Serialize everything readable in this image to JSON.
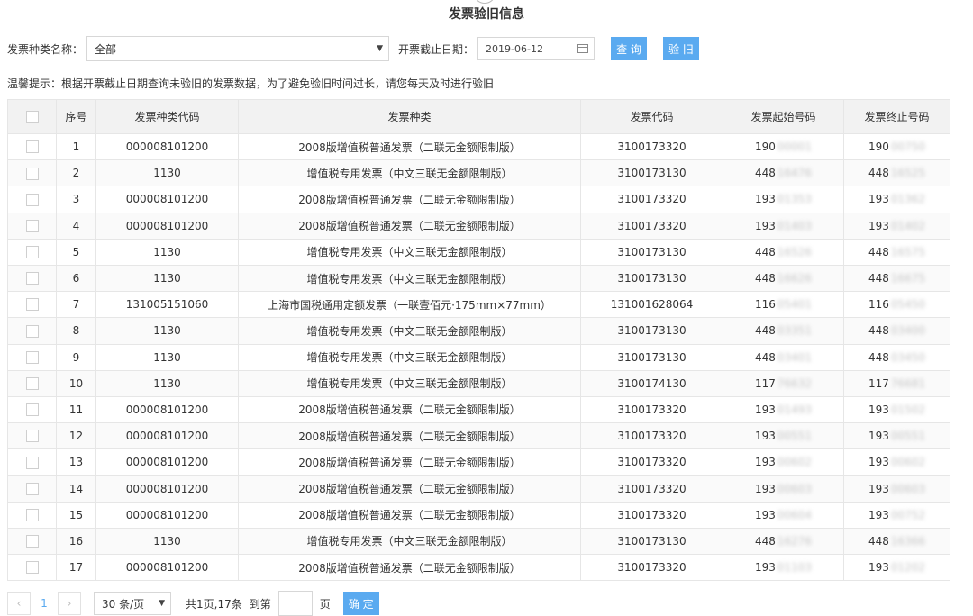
{
  "title": "发票验旧信息",
  "filters": {
    "type_label": "发票种类名称：",
    "type_value": "全部",
    "date_label": "开票截止日期：",
    "date_value": "2019-06-12",
    "query_label": "查 询",
    "check_label": "验 旧"
  },
  "tip": "温馨提示：根据开票截止日期查询未验旧的发票数据，为了避免验旧时间过长，请您每天及时进行验旧",
  "table": {
    "headers": {
      "seq": "序号",
      "type_code": "发票种类代码",
      "type_name": "发票种类",
      "invoice_code": "发票代码",
      "start_no": "发票起始号码",
      "end_no": "发票终止号码"
    },
    "rows": [
      {
        "seq": "1",
        "type_code": "000008101200",
        "type_name": "2008版增值税普通发票（二联无金额限制版）",
        "invoice_code": "3100173320",
        "start_no": "190",
        "start_no_hidden": "00001",
        "end_no": "190",
        "end_no_hidden": "00750"
      },
      {
        "seq": "2",
        "type_code": "1130",
        "type_name": "增值税专用发票（中文三联无金额限制版）",
        "invoice_code": "3100173130",
        "start_no": "448",
        "start_no_hidden": "16476",
        "end_no": "448",
        "end_no_hidden": "16525"
      },
      {
        "seq": "3",
        "type_code": "000008101200",
        "type_name": "2008版增值税普通发票（二联无金额限制版）",
        "invoice_code": "3100173320",
        "start_no": "193",
        "start_no_hidden": "01353",
        "end_no": "193",
        "end_no_hidden": "01362"
      },
      {
        "seq": "4",
        "type_code": "000008101200",
        "type_name": "2008版增值税普通发票（二联无金额限制版）",
        "invoice_code": "3100173320",
        "start_no": "193",
        "start_no_hidden": "01403",
        "end_no": "193",
        "end_no_hidden": "01402"
      },
      {
        "seq": "5",
        "type_code": "1130",
        "type_name": "增值税专用发票（中文三联无金额限制版）",
        "invoice_code": "3100173130",
        "start_no": "448",
        "start_no_hidden": "16526",
        "end_no": "448",
        "end_no_hidden": "16575"
      },
      {
        "seq": "6",
        "type_code": "1130",
        "type_name": "增值税专用发票（中文三联无金额限制版）",
        "invoice_code": "3100173130",
        "start_no": "448",
        "start_no_hidden": "16626",
        "end_no": "448",
        "end_no_hidden": "16675"
      },
      {
        "seq": "7",
        "type_code": "131005151060",
        "type_name": "上海市国税通用定额发票（一联壹佰元·175mm×77mm）",
        "invoice_code": "131001628064",
        "start_no": "116",
        "start_no_hidden": "05401",
        "end_no": "116",
        "end_no_hidden": "05450"
      },
      {
        "seq": "8",
        "type_code": "1130",
        "type_name": "增值税专用发票（中文三联无金额限制版）",
        "invoice_code": "3100173130",
        "start_no": "448",
        "start_no_hidden": "03351",
        "end_no": "448",
        "end_no_hidden": "03400"
      },
      {
        "seq": "9",
        "type_code": "1130",
        "type_name": "增值税专用发票（中文三联无金额限制版）",
        "invoice_code": "3100173130",
        "start_no": "448",
        "start_no_hidden": "03401",
        "end_no": "448",
        "end_no_hidden": "03450"
      },
      {
        "seq": "10",
        "type_code": "1130",
        "type_name": "增值税专用发票（中文三联无金额限制版）",
        "invoice_code": "3100174130",
        "start_no": "117",
        "start_no_hidden": "76632",
        "end_no": "117",
        "end_no_hidden": "76681"
      },
      {
        "seq": "11",
        "type_code": "000008101200",
        "type_name": "2008版增值税普通发票（二联无金额限制版）",
        "invoice_code": "3100173320",
        "start_no": "193",
        "start_no_hidden": "01493",
        "end_no": "193",
        "end_no_hidden": "01502"
      },
      {
        "seq": "12",
        "type_code": "000008101200",
        "type_name": "2008版增值税普通发票（二联无金额限制版）",
        "invoice_code": "3100173320",
        "start_no": "193",
        "start_no_hidden": "00551",
        "end_no": "193",
        "end_no_hidden": "00551"
      },
      {
        "seq": "13",
        "type_code": "000008101200",
        "type_name": "2008版增值税普通发票（二联无金额限制版）",
        "invoice_code": "3100173320",
        "start_no": "193",
        "start_no_hidden": "00602",
        "end_no": "193",
        "end_no_hidden": "00602"
      },
      {
        "seq": "14",
        "type_code": "000008101200",
        "type_name": "2008版增值税普通发票（二联无金额限制版）",
        "invoice_code": "3100173320",
        "start_no": "193",
        "start_no_hidden": "00603",
        "end_no": "193",
        "end_no_hidden": "00603"
      },
      {
        "seq": "15",
        "type_code": "000008101200",
        "type_name": "2008版增值税普通发票（二联无金额限制版）",
        "invoice_code": "3100173320",
        "start_no": "193",
        "start_no_hidden": "00604",
        "end_no": "193",
        "end_no_hidden": "00752"
      },
      {
        "seq": "16",
        "type_code": "1130",
        "type_name": "增值税专用发票（中文三联无金额限制版）",
        "invoice_code": "3100173130",
        "start_no": "448",
        "start_no_hidden": "16276",
        "end_no": "448",
        "end_no_hidden": "16366"
      },
      {
        "seq": "17",
        "type_code": "000008101200",
        "type_name": "2008版增值税普通发票（二联无金额限制版）",
        "invoice_code": "3100173320",
        "start_no": "193",
        "start_no_hidden": "01103",
        "end_no": "193",
        "end_no_hidden": "01202"
      }
    ]
  },
  "pager": {
    "prev": "‹",
    "current": "1",
    "next": "›",
    "size_value": "30 条/页",
    "total": "共1页,17条",
    "goto_label": "到第",
    "unit": "页",
    "ok_label": "确 定"
  },
  "icons": {
    "dropdown": "chevron-down-icon",
    "calendar": "calendar-icon"
  },
  "colors": {
    "accent": "#5aaaf0",
    "header_bg": "#f2f2f2",
    "border": "#e6e6e6"
  }
}
